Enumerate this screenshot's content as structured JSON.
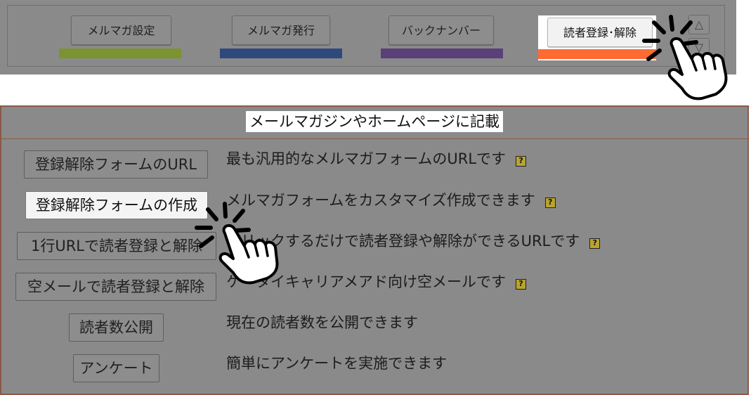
{
  "nav": {
    "tabs": [
      {
        "label": "メルマガ設定",
        "color": "#7c9331"
      },
      {
        "label": "メルマガ発行",
        "color": "#2e4a7c"
      },
      {
        "label": "バックナンバー",
        "color": "#5b3f78"
      },
      {
        "label": "読者登録･解除",
        "color": "#ff6a33",
        "active": true
      }
    ],
    "up_glyph": "△",
    "down_glyph": "▽"
  },
  "panel": {
    "title": "メールマガジンやホームページに記載",
    "rows": [
      {
        "button": "登録解除フォームのURL",
        "description": "最も汎用的なメルマガフォームのURLです",
        "help": true
      },
      {
        "button": "登録解除フォームの作成",
        "description": "メルマガフォームをカスタマイズ作成できます",
        "help": true,
        "active": true
      },
      {
        "button": "1行URLで読者登録と解除",
        "description": "クリックするだけで読者登録や解除ができるURLです",
        "help": true
      },
      {
        "button": "空メールで読者登録と解除",
        "description": "ケータイキャリアメアド向け空メールです",
        "help": true
      },
      {
        "button": "読者数公開",
        "description": "現在の読者数を公開できます",
        "help": false
      },
      {
        "button": "アンケート",
        "description": "簡単にアンケートを実施できます",
        "help": false
      }
    ],
    "help_glyph": "?"
  }
}
